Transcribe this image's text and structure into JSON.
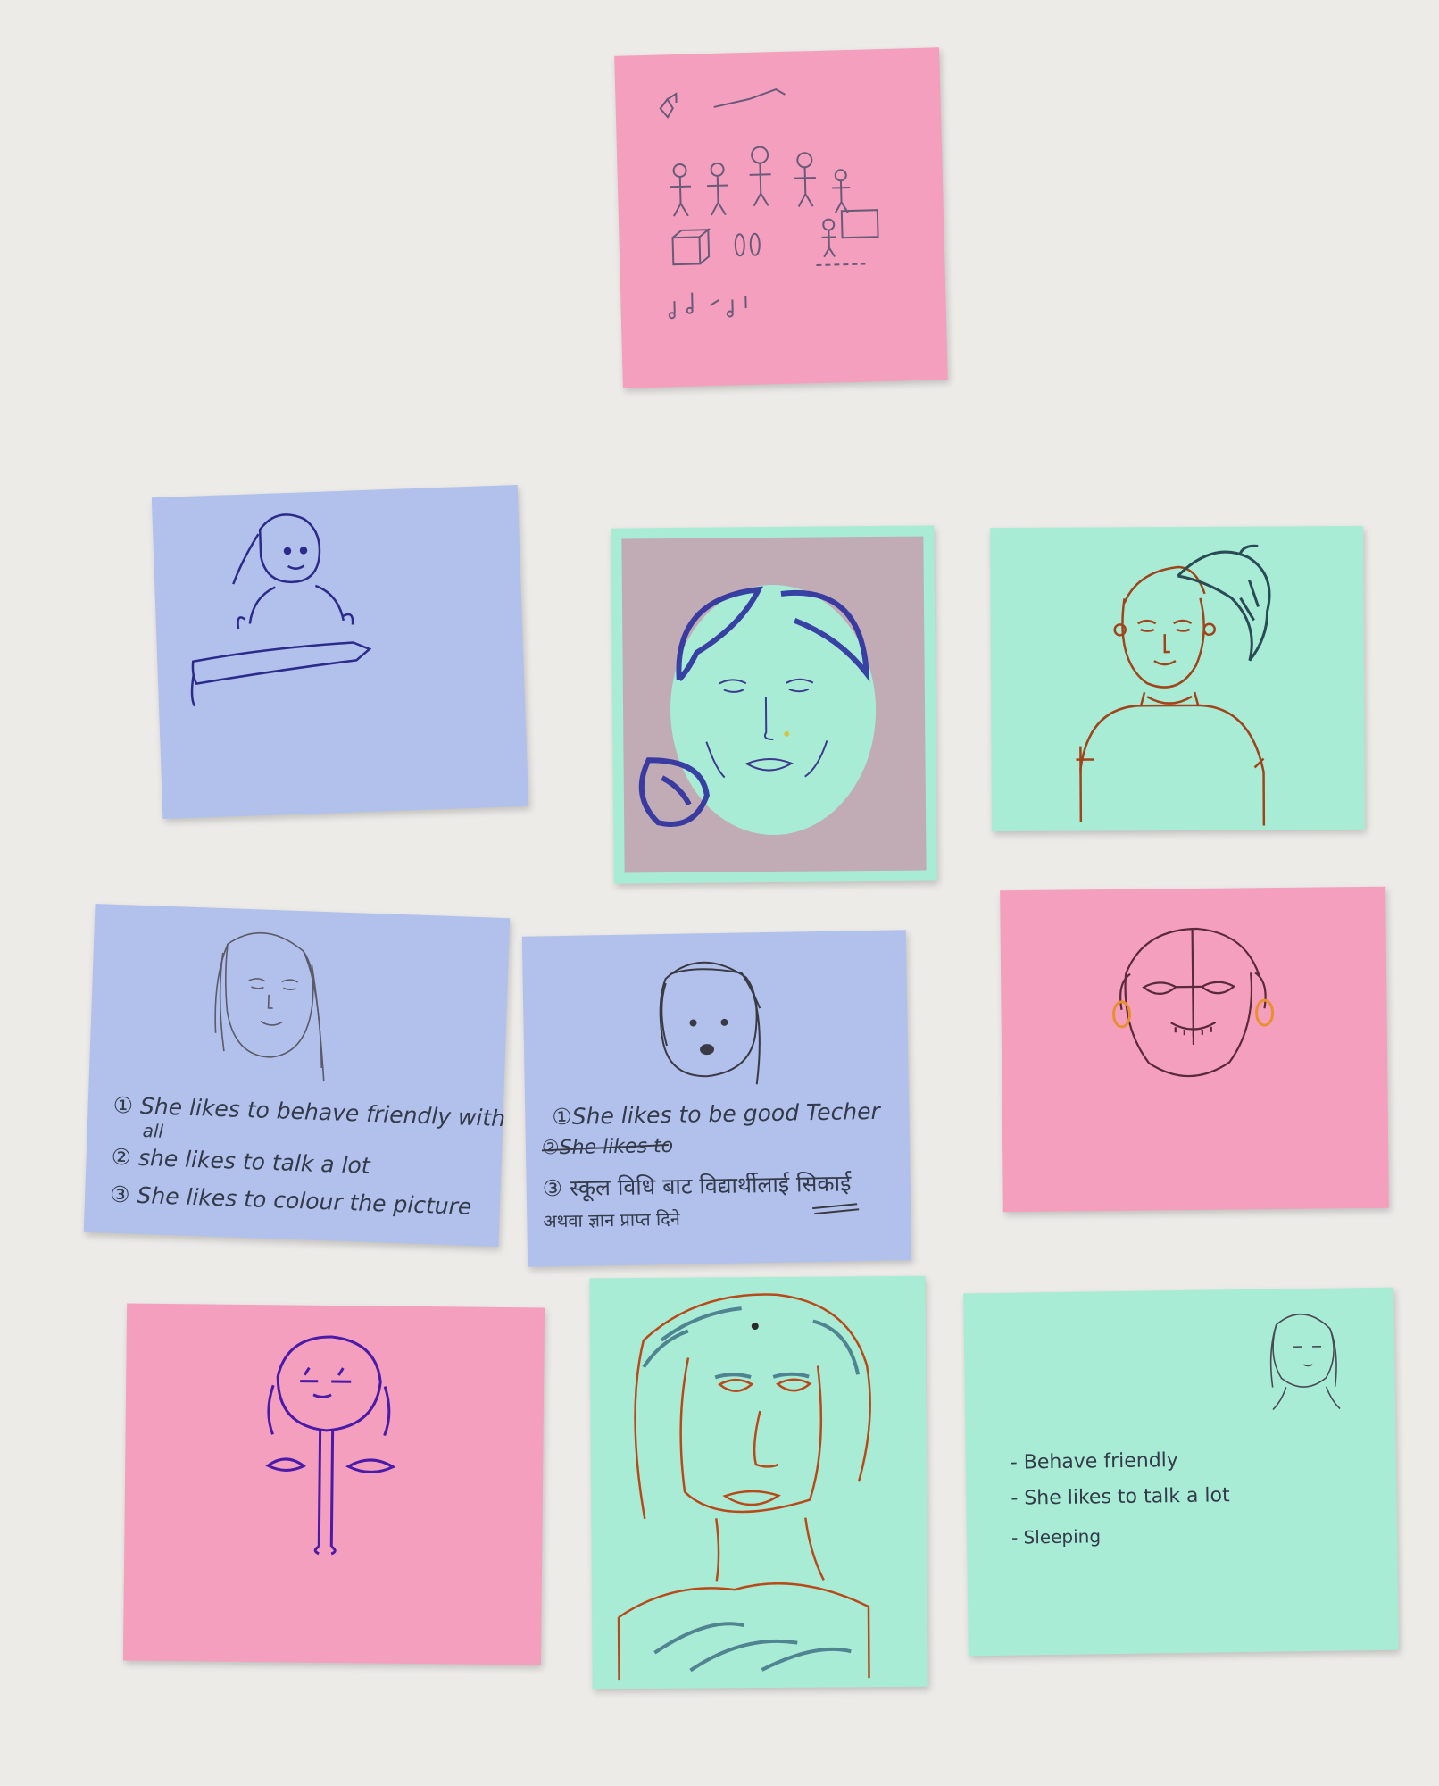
{
  "notes": {
    "n5": {
      "lines": [
        "① She likes to behave friendly with",
        "all",
        "② she likes to talk a lot",
        "③ She likes to colour the picture"
      ]
    },
    "n6": {
      "lines": [
        "①She likes to be good Techer",
        "②She likes to",
        "③ स्कूल विधि बाट विद्यार्थीलाई सिकाई",
        "अथवा ज्ञान प्राप्त दिने"
      ]
    },
    "n10": {
      "lines": [
        "- Behave   friendly",
        "- She   likes  to   talk  a lot",
        "- Sleeping"
      ]
    }
  },
  "colors": {
    "pink_note": "#f49fbd",
    "blue_note": "#b2c1ec",
    "mint_note": "#a9ecd6",
    "table": "#ecebe8"
  }
}
